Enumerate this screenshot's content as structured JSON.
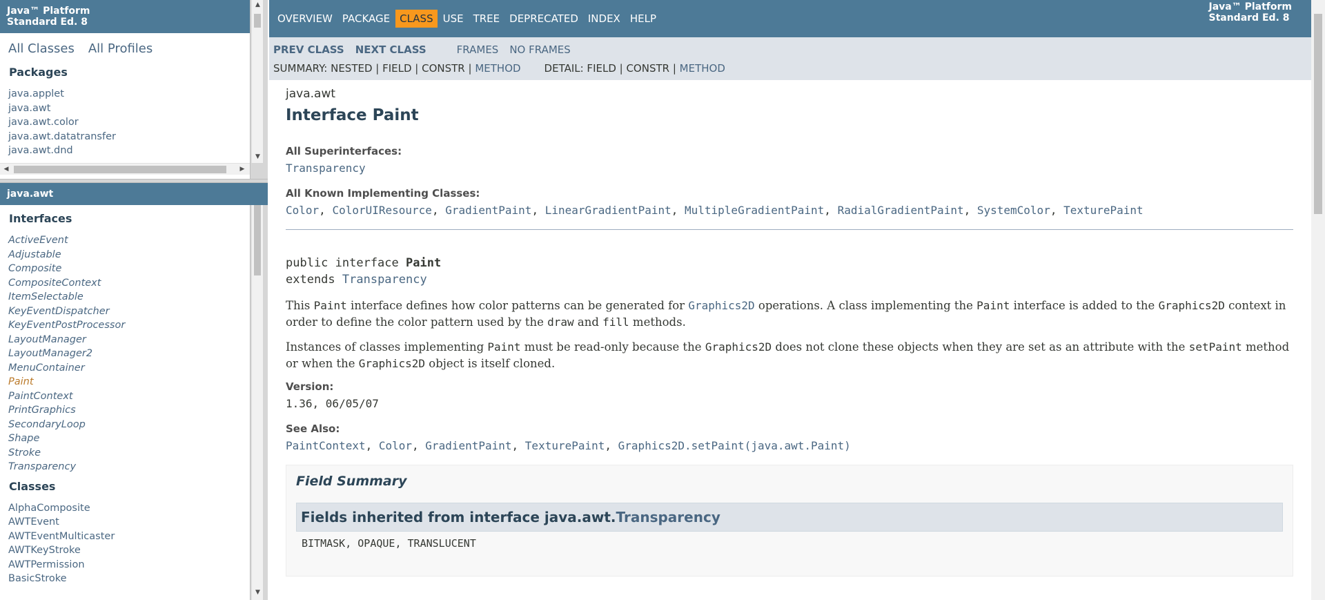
{
  "platform": {
    "line1": "Java™ Platform",
    "line2": "Standard Ed. 8"
  },
  "left_top": {
    "all_classes": "All Classes",
    "all_profiles": "All Profiles",
    "packages_title": "Packages",
    "packages": [
      "java.applet",
      "java.awt",
      "java.awt.color",
      "java.awt.datatransfer",
      "java.awt.dnd"
    ]
  },
  "left_bottom": {
    "package_header": "java.awt",
    "interfaces_title": "Interfaces",
    "interfaces": [
      "ActiveEvent",
      "Adjustable",
      "Composite",
      "CompositeContext",
      "ItemSelectable",
      "KeyEventDispatcher",
      "KeyEventPostProcessor",
      "LayoutManager",
      "LayoutManager2",
      "MenuContainer",
      "Paint",
      "PaintContext",
      "PrintGraphics",
      "SecondaryLoop",
      "Shape",
      "Stroke",
      "Transparency"
    ],
    "current_interface": "Paint",
    "classes_title": "Classes",
    "classes": [
      "AlphaComposite",
      "AWTEvent",
      "AWTEventMulticaster",
      "AWTKeyStroke",
      "AWTPermission",
      "BasicStroke"
    ]
  },
  "topnav": {
    "items": [
      "OVERVIEW",
      "PACKAGE",
      "CLASS",
      "USE",
      "TREE",
      "DEPRECATED",
      "INDEX",
      "HELP"
    ],
    "active": "CLASS"
  },
  "subnav": {
    "prev_class": "PREV CLASS",
    "next_class": "NEXT CLASS",
    "frames": "FRAMES",
    "no_frames": "NO FRAMES",
    "summary": {
      "label": "SUMMARY: NESTED | FIELD | CONSTR | ",
      "method": "METHOD"
    },
    "detail": {
      "label": "DETAIL: FIELD | CONSTR | ",
      "method": "METHOD"
    }
  },
  "content": {
    "package": "java.awt",
    "title": "Interface Paint",
    "superinterfaces_label": "All Superinterfaces:",
    "superinterfaces": [
      "Transparency"
    ],
    "implementing_label": "All Known Implementing Classes:",
    "implementing": [
      "Color",
      "ColorUIResource",
      "GradientPaint",
      "LinearGradientPaint",
      "MultipleGradientPaint",
      "RadialGradientPaint",
      "SystemColor",
      "TexturePaint"
    ],
    "sig_line1_prefix": "public interface ",
    "sig_name": "Paint",
    "sig_line2_prefix": "extends ",
    "sig_extends": "Transparency",
    "para1": {
      "a": "This ",
      "code1": "Paint",
      "b": " interface defines how color patterns can be generated for ",
      "link1": "Graphics2D",
      "c": " operations. A class implementing the ",
      "code2": "Paint",
      "d": " interface is added to the ",
      "code3": "Graphics2D",
      "e": " context in order to define the color pattern used by the ",
      "code4": "draw",
      "f": " and ",
      "code5": "fill",
      "g": " methods."
    },
    "para2": {
      "a": "Instances of classes implementing ",
      "code1": "Paint",
      "b": " must be read-only because the ",
      "code2": "Graphics2D",
      "c": " does not clone these objects when they are set as an attribute with the ",
      "code3": "setPaint",
      "d": " method or when the ",
      "code4": "Graphics2D",
      "e": " object is itself cloned."
    },
    "version_label": "Version:",
    "version": "1.36, 06/05/07",
    "seealso_label": "See Also:",
    "seealso": [
      "PaintContext",
      "Color",
      "GradientPaint",
      "TexturePaint",
      "Graphics2D.setPaint(java.awt.Paint)"
    ],
    "field_summary_title": "Field Summary",
    "inherited_prefix": "Fields inherited from interface java.awt.",
    "inherited_link": "Transparency",
    "inherited_fields": "BITMASK, OPAQUE, TRANSLUCENT"
  }
}
